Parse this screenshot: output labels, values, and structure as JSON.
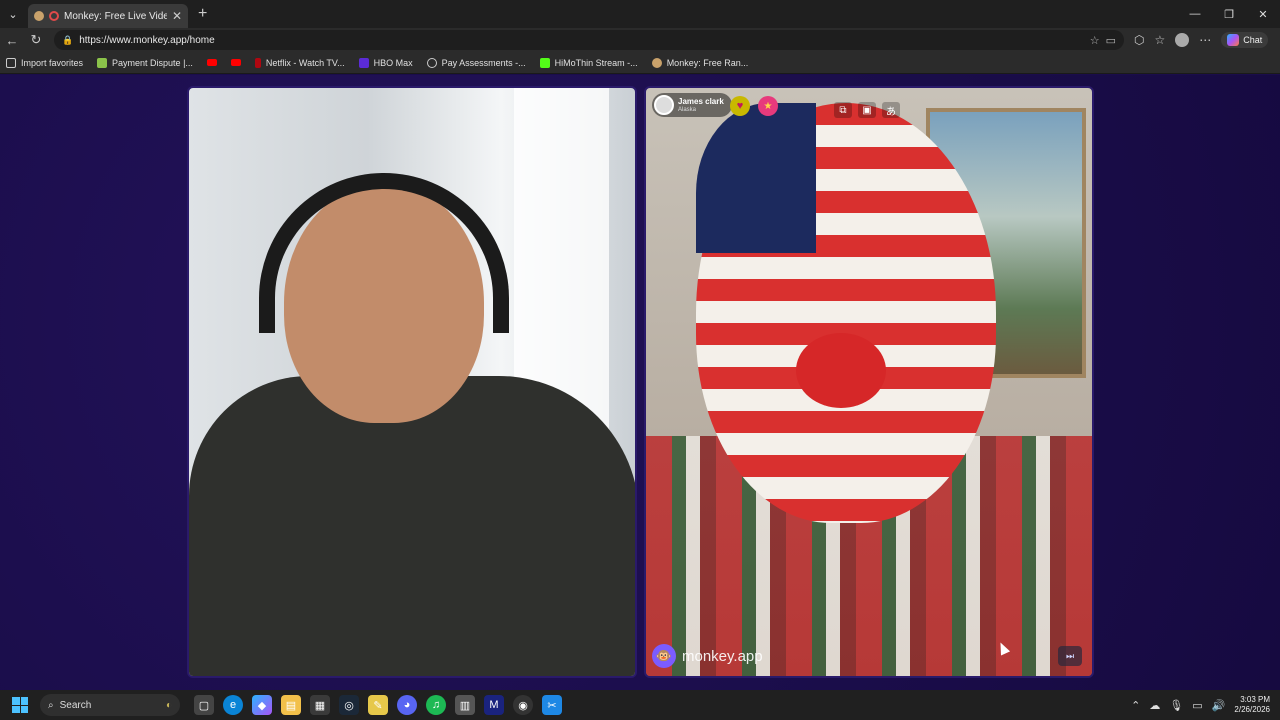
{
  "browser": {
    "tab": {
      "title": "Monkey: Free Live Video Chat"
    },
    "url": "https://www.monkey.app/home",
    "chat_label": "Chat",
    "bookmarks": [
      {
        "label": "Import favorites",
        "icon": "import-icon"
      },
      {
        "label": "Payment Dispute |...",
        "icon": "bookmark-icon"
      },
      {
        "label": "",
        "icon": "youtube-icon"
      },
      {
        "label": "",
        "icon": "youtube-icon"
      },
      {
        "label": "Netflix - Watch TV...",
        "icon": "netflix-icon"
      },
      {
        "label": "HBO Max",
        "icon": "hbo-icon"
      },
      {
        "label": "Pay Assessments -...",
        "icon": "globe-icon"
      },
      {
        "label": "HiMoThin Stream -...",
        "icon": "kick-icon"
      },
      {
        "label": "Monkey: Free Ran...",
        "icon": "monkey-icon"
      }
    ]
  },
  "video_chat": {
    "remote_user": {
      "name": "James clark",
      "location": "Alaska"
    },
    "brand": "monkey.app"
  },
  "taskbar": {
    "search_placeholder": "Search",
    "time": "3:03 PM",
    "date": "2/26/2026"
  },
  "colors": {
    "page_bg": "#1a0d4a",
    "brand_purple": "#7b5cff",
    "badge_gold": "#c8b800",
    "badge_pink": "#e73a7c"
  }
}
